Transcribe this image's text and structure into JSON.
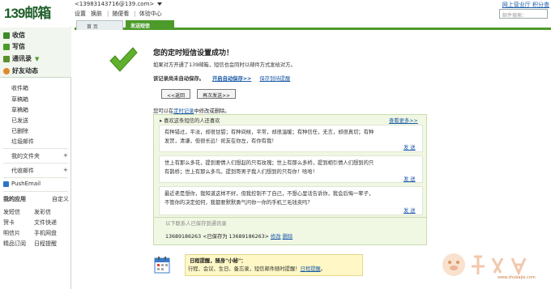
{
  "header": {
    "logo": "139邮箱",
    "account": "<13983143716@139.com>",
    "links": [
      "设置",
      "换肤",
      "|",
      "随便看",
      "|",
      "体验中心"
    ],
    "right_link_1": "网上营业厅",
    "right_link_2": "积分查",
    "search_placeholder": "邮件搜索："
  },
  "tabs": [
    {
      "label": "首 页"
    },
    {
      "label": "发送短信"
    }
  ],
  "sidebar": {
    "main": [
      {
        "label": "收信",
        "icon": "inbox-icon",
        "color": "#3c8a2a"
      },
      {
        "label": "写信",
        "icon": "compose-icon",
        "color": "#4c9a2a"
      },
      {
        "label": "通讯录",
        "icon": "contacts-icon",
        "color": "#5a8f2e",
        "chevron": "▼"
      },
      {
        "label": "好友动态",
        "icon": "friends-icon",
        "color": "#e08a2a"
      }
    ],
    "folders": [
      "收件箱",
      "草稿箱",
      "草稿箱",
      "已发送",
      "已删除",
      "垃圾邮件"
    ],
    "myfolders": "我的文件夹",
    "myfolders_plus": "+",
    "proxy": "代收邮件",
    "proxy_plus": "+",
    "pushemail": "PushEmail",
    "myapp": "我的应用",
    "custom": "自定义",
    "apps": [
      [
        "发短信",
        "发彩信"
      ],
      [
        "贺卡",
        "文件快递"
      ],
      [
        "明信片",
        "手机网盘"
      ],
      [
        "精品订阅",
        "日程提醒"
      ]
    ]
  },
  "main": {
    "title": "您的定时短信设置成功！",
    "description": "如果对方开通了139邮箱，短信也会同时以邮件方式发给对方。",
    "notsaved": "该记录尚未自动保存。",
    "save_link": "开启自动保存>>",
    "save_reminder": "保存到待提醒",
    "back_button": "<<返回",
    "again_button": "再次发送>>",
    "can_modify_prefix": "您可以在",
    "can_modify_link": "定时记录",
    "can_modify_suffix": "中修改或删除。",
    "suggest_head": "▸ 喜欢这条短信的人还喜欢",
    "suggest_more": "查看更多>>",
    "messages": [
      {
        "text": "有种错过，平淡，却很甘甜；有种间候，平常，却很温暖；有种信任，无言，却很真切；有种发贺，清谦，但很长远！祝友在你左，有你有我！",
        "send": "发 送"
      },
      {
        "text": "世上有那么多花，提到要情人们想起的只有玫瑰；世上有那么多桥，提到相引情人们想到的只有鹊桥；世上有那么多鸟，提到哥男子我人们想到的只有你！哈哈！",
        "send": "发 送"
      },
      {
        "text": "最近老是想你，我知道这样不好，但我控制不了自己，不想心里话告诉你，我会后悔一辈子，不管你的决定如何，我都要默默勇气问你一你的手机三毛钱卖吗？",
        "send": "发 送"
      }
    ],
    "saved_label": "以下联系人已保存到通讯录",
    "saved_number": "13689186263 <已保存为 13689186263>",
    "saved_edit": "修改",
    "saved_delete": "删除",
    "remind_title": "日程提醒，随身\"小秘\"：",
    "remind_text": "行程、会议、生日、备忘录，短信邮件随时提醒！",
    "remind_link": "日程提醒",
    "remind_suffix": "。"
  },
  "watermark": {
    "text": "www.zhubajie.com"
  },
  "colors": {
    "brand_green": "#4c9a2a",
    "check_green": "#5fb02c",
    "link_blue": "#1a5aa8"
  }
}
